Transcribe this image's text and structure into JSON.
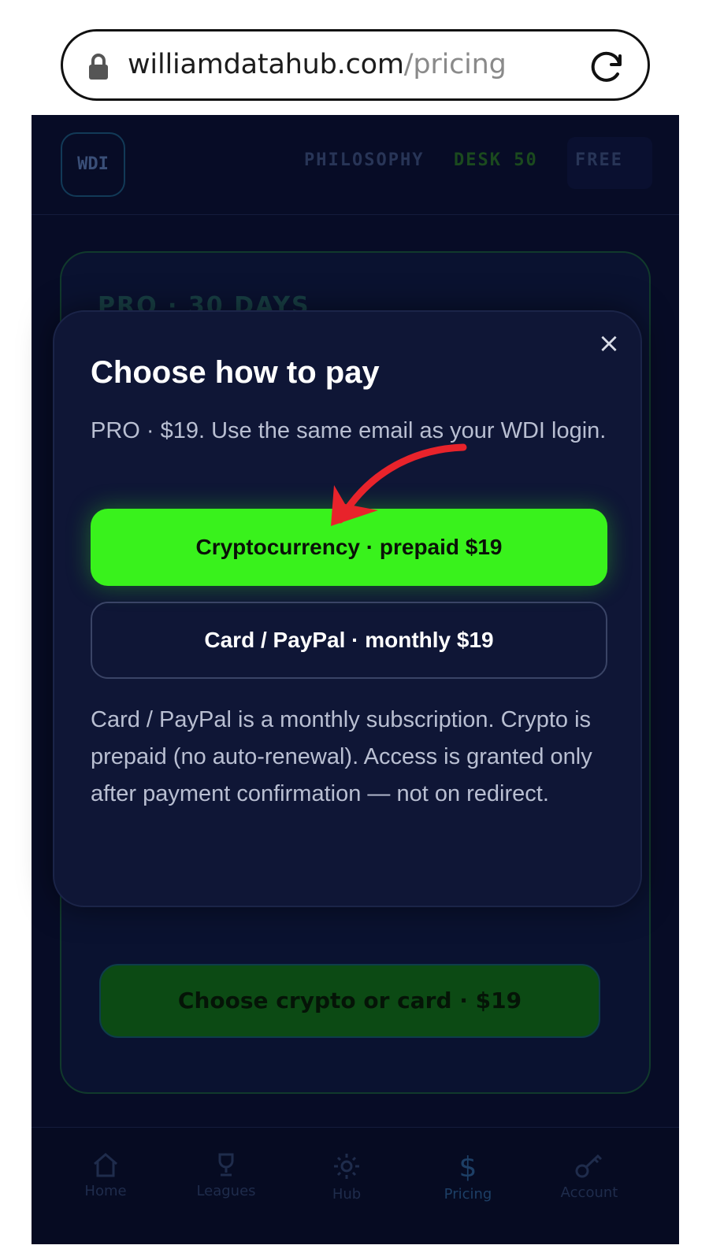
{
  "browser": {
    "url_domain": "williamdatahub.com",
    "url_path": "/pricing"
  },
  "topnav": {
    "logo": "WDI",
    "links": [
      "PHILOSOPHY",
      "DESK 50",
      "FREE"
    ]
  },
  "pro_card": {
    "title": "PRO · 30 DAYS",
    "cta_label": "Choose crypto or card · $19"
  },
  "tabbar": {
    "items": [
      {
        "label": "Home",
        "icon": "home-icon"
      },
      {
        "label": "Leagues",
        "icon": "trophy-icon"
      },
      {
        "label": "Hub",
        "icon": "sun-icon"
      },
      {
        "label": "Pricing",
        "icon": "dollar-icon"
      },
      {
        "label": "Account",
        "icon": "key-icon"
      }
    ]
  },
  "modal": {
    "title": "Choose how to pay",
    "subtitle": "PRO · $19. Use the same email as your WDI login.",
    "crypto_button": "Cryptocurrency · prepaid $19",
    "card_button": "Card / PayPal · monthly $19",
    "note": "Card / PayPal is a monthly subscription. Crypto is prepaid (no auto-renewal). Access is granted only after payment confirmation — not on redirect.",
    "close_label": "×"
  },
  "colors": {
    "accent_green": "#39f21c",
    "modal_bg": "#0f1636",
    "page_bg": "#070c26",
    "annotation_red": "#e8232b"
  }
}
